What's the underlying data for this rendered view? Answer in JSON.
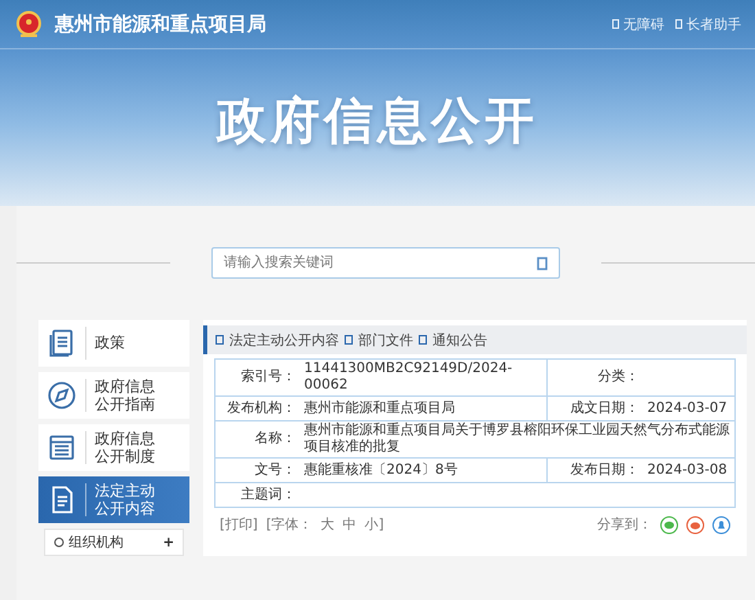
{
  "header": {
    "title": "惠州市能源和重点项目局",
    "links": [
      "无障碍",
      "长者助手"
    ]
  },
  "banner": {
    "title": "政府信息公开"
  },
  "search": {
    "placeholder": "请输入搜索关键词"
  },
  "sidebar": {
    "items": [
      {
        "label": "政策",
        "selected": false
      },
      {
        "label": "政府信息公开指南",
        "selected": false
      },
      {
        "label": "政府信息公开制度",
        "selected": false
      },
      {
        "label": "法定主动公开内容",
        "selected": true
      }
    ],
    "sub_items": [
      {
        "label": "组织机构",
        "expanded": false,
        "toggle": "+"
      }
    ]
  },
  "breadcrumb": [
    "法定主动公开内容",
    "部门文件",
    "通知公告"
  ],
  "info_table": {
    "rows": [
      [
        {
          "label": "索引号：",
          "value": "11441300MB2C92149D/2024-00062"
        },
        {
          "label": "分类："
        }
      ],
      [
        {
          "label": "发布机构：",
          "value": "惠州市能源和重点项目局"
        },
        {
          "label": "成文日期：",
          "value": "2024-03-07"
        }
      ],
      [
        {
          "label": "名称：",
          "value": "惠州市能源和重点项目局关于博罗县榕阳环保工业园天然气分布式能源项目核准的批复"
        }
      ],
      [
        {
          "label": "文号：",
          "value": "惠能重核准〔2024〕8号"
        },
        {
          "label": "发布日期：",
          "value": "2024-03-08"
        }
      ],
      [
        {
          "label": "主题词："
        }
      ]
    ]
  },
  "tools": {
    "print": "[打印]",
    "font_prefix": "[字体：",
    "font_sizes": [
      "大",
      "中",
      "小]"
    ],
    "share_label": "分享到："
  }
}
